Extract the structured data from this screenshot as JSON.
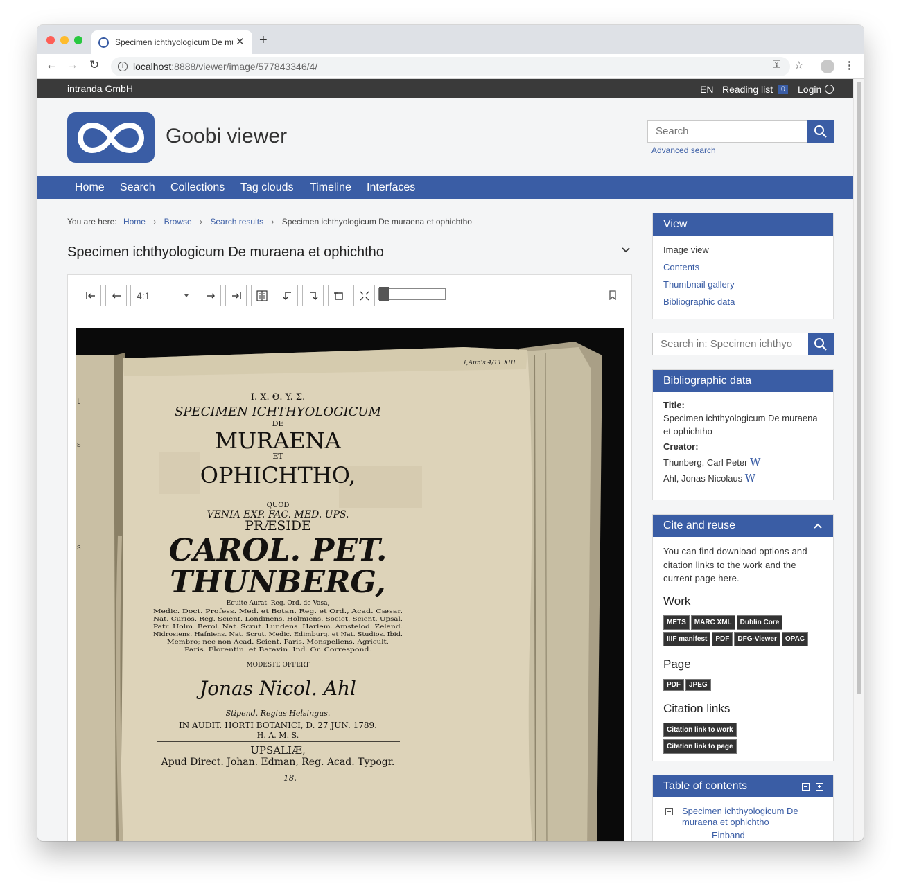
{
  "browser": {
    "tab_title": "Specimen ichthyologicum De muraena et ophichtho",
    "url_host": "localhost",
    "url_path": ":8888/viewer/image/577843346/4/"
  },
  "topbar": {
    "company": "intranda GmbH",
    "language": "EN",
    "reading_list": "Reading list",
    "reading_count": "0",
    "login": "Login"
  },
  "header": {
    "site_title": "Goobi viewer",
    "search_placeholder": "Search",
    "advanced_search": "Advanced search"
  },
  "mainnav": [
    "Home",
    "Search",
    "Collections",
    "Tag clouds",
    "Timeline",
    "Interfaces"
  ],
  "breadcrumb": {
    "prefix": "You are here:",
    "items": [
      "Home",
      "Browse",
      "Search results"
    ],
    "current": "Specimen ichthyologicum De muraena et ophichtho"
  },
  "document": {
    "title": "Specimen ichthyologicum De muraena et ophichtho",
    "zoom": "4:1"
  },
  "scan_text": {
    "l1": "I. X. Θ. Y. Σ.",
    "l2": "SPECIMEN ICHTHYOLOGICUM",
    "l3": "DE",
    "l4": "MURAENA",
    "l5": "ET",
    "l6": "OPHICHTHO,",
    "l7": "QUOD",
    "l8": "VENIA EXP. FAC. MED. UPS.",
    "l9": "PRÆSIDE",
    "l10": "CAROL. PET.",
    "l11": "THUNBERG,",
    "l12": "Equite Aurat. Reg. Ord. de Vasa,",
    "l13": "Medic. Doct. Profess. Med. et Botan. Reg. et Ord., Acad. Cæsar.",
    "l14": "Nat. Curios. Reg. Scient. Londinens. Holmiens. Societ. Scient. Upsal.",
    "l15": "Patr. Holm. Berol. Nat. Scrut. Lundens. Harlem. Amstelod. Zeland.",
    "l16": "Nidrosiens. Hafniens. Nat. Scrut. Medic. Edimburg. et Nat. Studios. Ibid.",
    "l17": "Membro; nec non Acad. Scient. Paris. Monspeliens. Agricult.",
    "l18": "Paris. Florentin. et Batavin. Ind. Or. Correspond.",
    "l19": "MODESTE OFFERT",
    "l20": "Jonas Nicol. Ahl",
    "l21": "Stipend. Regius Helsingus.",
    "l22": "IN AUDIT. HORTI BOTANICI, D. 27 JUN. 1789.",
    "l23": "H. A. M. S.",
    "l24": "UPSALIÆ,",
    "l25": "Apud Direct. Johan. Edman, Reg. Acad. Typogr."
  },
  "sidebar": {
    "view": {
      "title": "View",
      "current": "Image view",
      "links": [
        "Contents",
        "Thumbnail gallery",
        "Bibliographic data"
      ]
    },
    "search_in_placeholder": "Search in: Specimen ichthyo",
    "biblio": {
      "title": "Bibliographic data",
      "title_label": "Title:",
      "title_value": "Specimen ichthyologicum De muraena et ophichtho",
      "creator_label": "Creator:",
      "creators": [
        "Thunberg, Carl Peter",
        "Ahl, Jonas Nicolaus"
      ],
      "wiki_glyph": "W"
    },
    "cite": {
      "title": "Cite and reuse",
      "intro": "You can find download options and citation links to the work and the current page here.",
      "work_heading": "Work",
      "work_tags": [
        "METS",
        "MARC XML",
        "Dublin Core",
        "IIIF manifest",
        "PDF",
        "DFG-Viewer",
        "OPAC"
      ],
      "page_heading": "Page",
      "page_tags": [
        "PDF",
        "JPEG"
      ],
      "citation_heading": "Citation links",
      "citation_tags": [
        "Citation link to work",
        "Citation link to page"
      ]
    },
    "toc": {
      "title": "Table of contents",
      "items": [
        "Specimen ichthyologicum De muraena et ophichtho",
        "Einband"
      ]
    }
  }
}
